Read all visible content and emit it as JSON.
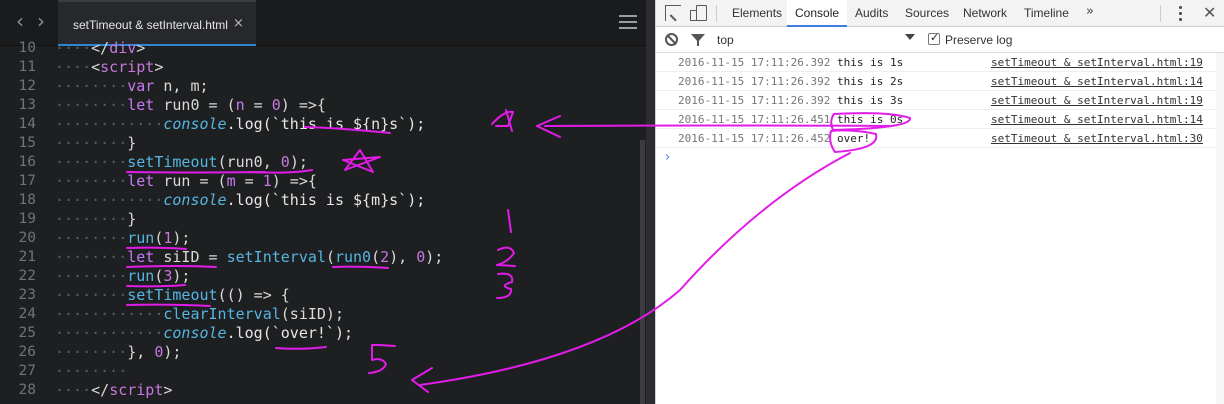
{
  "editor": {
    "tab": {
      "title": "setTimeout & setInterval.html",
      "close": "×"
    },
    "nav": {
      "back": "‹",
      "forward": "›"
    },
    "lines": [
      {
        "n": "10",
        "segments": [
          {
            "t": "····",
            "c": "dot"
          },
          {
            "t": "</",
            "c": "op"
          },
          {
            "t": "div",
            "c": "tag"
          },
          {
            "t": ">",
            "c": "op"
          }
        ]
      },
      {
        "n": "11",
        "segments": [
          {
            "t": "····",
            "c": "dot"
          },
          {
            "t": "<",
            "c": "op"
          },
          {
            "t": "script",
            "c": "tag"
          },
          {
            "t": ">",
            "c": "op"
          }
        ]
      },
      {
        "n": "12",
        "segments": [
          {
            "t": "········",
            "c": "dot"
          },
          {
            "t": "var",
            "c": "kw"
          },
          {
            "t": " n, m;",
            "c": "op"
          }
        ]
      },
      {
        "n": "13",
        "segments": [
          {
            "t": "········",
            "c": "dot"
          },
          {
            "t": "let",
            "c": "kw"
          },
          {
            "t": " run0 = (",
            "c": "op"
          },
          {
            "t": "n",
            "c": "kw"
          },
          {
            "t": " = ",
            "c": "op"
          },
          {
            "t": "0",
            "c": "num"
          },
          {
            "t": ") =>{",
            "c": "op"
          }
        ]
      },
      {
        "n": "14",
        "segments": [
          {
            "t": "············",
            "c": "dot"
          },
          {
            "t": "console",
            "c": "ital"
          },
          {
            "t": ".log(`this is ${n}s`);",
            "c": "str"
          }
        ]
      },
      {
        "n": "15",
        "segments": [
          {
            "t": "········",
            "c": "dot"
          },
          {
            "t": "}",
            "c": "op"
          }
        ]
      },
      {
        "n": "16",
        "segments": [
          {
            "t": "········",
            "c": "dot"
          },
          {
            "t": "setTimeout",
            "c": "fn"
          },
          {
            "t": "(run0, ",
            "c": "op"
          },
          {
            "t": "0",
            "c": "num"
          },
          {
            "t": ");",
            "c": "op"
          }
        ]
      },
      {
        "n": "17",
        "segments": [
          {
            "t": "········",
            "c": "dot"
          },
          {
            "t": "let",
            "c": "kw"
          },
          {
            "t": " run = (",
            "c": "op"
          },
          {
            "t": "m",
            "c": "kw"
          },
          {
            "t": " = ",
            "c": "op"
          },
          {
            "t": "1",
            "c": "num"
          },
          {
            "t": ") =>{",
            "c": "op"
          }
        ]
      },
      {
        "n": "18",
        "segments": [
          {
            "t": "············",
            "c": "dot"
          },
          {
            "t": "console",
            "c": "ital"
          },
          {
            "t": ".log(`this is ${m}s`);",
            "c": "str"
          }
        ]
      },
      {
        "n": "19",
        "segments": [
          {
            "t": "········",
            "c": "dot"
          },
          {
            "t": "}",
            "c": "op"
          }
        ]
      },
      {
        "n": "20",
        "segments": [
          {
            "t": "········",
            "c": "dot"
          },
          {
            "t": "run",
            "c": "fn"
          },
          {
            "t": "(",
            "c": "op"
          },
          {
            "t": "1",
            "c": "num"
          },
          {
            "t": ");",
            "c": "op"
          }
        ]
      },
      {
        "n": "21",
        "segments": [
          {
            "t": "········",
            "c": "dot"
          },
          {
            "t": "let",
            "c": "kw"
          },
          {
            "t": " siID = ",
            "c": "op"
          },
          {
            "t": "setInterval",
            "c": "fn"
          },
          {
            "t": "(",
            "c": "op"
          },
          {
            "t": "run0",
            "c": "fn"
          },
          {
            "t": "(",
            "c": "op"
          },
          {
            "t": "2",
            "c": "num"
          },
          {
            "t": "), ",
            "c": "op"
          },
          {
            "t": "0",
            "c": "num"
          },
          {
            "t": ");",
            "c": "op"
          }
        ]
      },
      {
        "n": "22",
        "segments": [
          {
            "t": "········",
            "c": "dot"
          },
          {
            "t": "run",
            "c": "fn"
          },
          {
            "t": "(",
            "c": "op"
          },
          {
            "t": "3",
            "c": "num"
          },
          {
            "t": ");",
            "c": "op"
          }
        ]
      },
      {
        "n": "23",
        "segments": [
          {
            "t": "········",
            "c": "dot"
          },
          {
            "t": "setTimeout",
            "c": "fn"
          },
          {
            "t": "(() => {",
            "c": "op"
          }
        ]
      },
      {
        "n": "24",
        "segments": [
          {
            "t": "············",
            "c": "dot"
          },
          {
            "t": "clearInterval",
            "c": "fn"
          },
          {
            "t": "(siID);",
            "c": "op"
          }
        ]
      },
      {
        "n": "25",
        "segments": [
          {
            "t": "············",
            "c": "dot"
          },
          {
            "t": "console",
            "c": "ital"
          },
          {
            "t": ".log(`over!`);",
            "c": "str"
          }
        ]
      },
      {
        "n": "26",
        "segments": [
          {
            "t": "········",
            "c": "dot"
          },
          {
            "t": "}, ",
            "c": "op"
          },
          {
            "t": "0",
            "c": "num"
          },
          {
            "t": ");",
            "c": "op"
          }
        ]
      },
      {
        "n": "27",
        "segments": [
          {
            "t": "········",
            "c": "dot"
          }
        ]
      },
      {
        "n": "28",
        "segments": [
          {
            "t": "····",
            "c": "dot"
          },
          {
            "t": "</",
            "c": "op"
          },
          {
            "t": "script",
            "c": "tag"
          },
          {
            "t": ">",
            "c": "op"
          }
        ]
      }
    ]
  },
  "devtools": {
    "tabs": [
      "Elements",
      "Console",
      "Audits",
      "Sources",
      "Network",
      "Timeline"
    ],
    "active_tab": "Console",
    "more": "»",
    "close": "✕",
    "console_bar": {
      "context": "top",
      "preserve_log_label": "Preserve log",
      "preserve_log_checked": true
    },
    "prompt": "›",
    "logs": [
      {
        "time": "2016-11-15 17:11:26.392",
        "msg": "this is 1s",
        "src": "setTimeout & setInterval.html:19"
      },
      {
        "time": "2016-11-15 17:11:26.392",
        "msg": "this is 2s",
        "src": "setTimeout & setInterval.html:14"
      },
      {
        "time": "2016-11-15 17:11:26.392",
        "msg": "this is 3s",
        "src": "setTimeout & setInterval.html:19"
      },
      {
        "time": "2016-11-15 17:11:26.451",
        "msg": "this is 0s",
        "src": "setTimeout & setInterval.html:14"
      },
      {
        "time": "2016-11-15 17:11:26.452",
        "msg": "over!",
        "src": "setTimeout & setInterval.html:30"
      }
    ]
  },
  "annotations": {
    "color": "#e21ce8",
    "labels": [
      "4",
      "1",
      "2",
      "3",
      "5"
    ]
  }
}
